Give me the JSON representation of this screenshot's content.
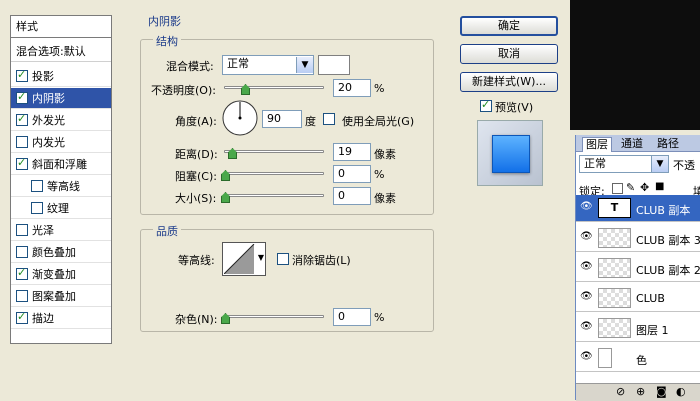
{
  "sidebar": {
    "header": "样式",
    "blend_options": "混合选项:默认",
    "items": [
      {
        "label": "投影",
        "checked": true,
        "indent": false,
        "selected": false
      },
      {
        "label": "内阴影",
        "checked": true,
        "indent": false,
        "selected": true
      },
      {
        "label": "外发光",
        "checked": true,
        "indent": false,
        "selected": false
      },
      {
        "label": "内发光",
        "checked": false,
        "indent": false,
        "selected": false
      },
      {
        "label": "斜面和浮雕",
        "checked": true,
        "indent": false,
        "selected": false
      },
      {
        "label": "等高线",
        "checked": false,
        "indent": true,
        "selected": false
      },
      {
        "label": "纹理",
        "checked": false,
        "indent": true,
        "selected": false
      },
      {
        "label": "光泽",
        "checked": false,
        "indent": false,
        "selected": false
      },
      {
        "label": "颜色叠加",
        "checked": false,
        "indent": false,
        "selected": false
      },
      {
        "label": "渐变叠加",
        "checked": true,
        "indent": false,
        "selected": false
      },
      {
        "label": "图案叠加",
        "checked": false,
        "indent": false,
        "selected": false
      },
      {
        "label": "描边",
        "checked": true,
        "indent": false,
        "selected": false
      }
    ]
  },
  "main": {
    "section_title": "内阴影",
    "structure": {
      "title": "结构",
      "blend_mode_label": "混合模式:",
      "blend_mode_value": "正常",
      "opacity_label": "不透明度(O):",
      "opacity_value": "20",
      "opacity_unit": "%",
      "opacity_fraction": 0.2,
      "angle_label": "角度(A):",
      "angle_value": "90",
      "angle_unit": "度",
      "global_light_label": "使用全局光(G)",
      "global_light_checked": false,
      "distance_label": "距离(D):",
      "distance_value": "19",
      "distance_unit": "像素",
      "distance_fraction": 0.07,
      "choke_label": "阻塞(C):",
      "choke_value": "0",
      "choke_unit": "%",
      "size_label": "大小(S):",
      "size_value": "0",
      "size_unit": "像素"
    },
    "quality": {
      "title": "品质",
      "contour_label": "等高线:",
      "antialias_label": "消除锯齿(L)",
      "antialias_checked": false,
      "noise_label": "杂色(N):",
      "noise_value": "0",
      "noise_unit": "%"
    }
  },
  "buttons": {
    "ok": "确定",
    "cancel": "取消",
    "new_style": "新建样式(W)...",
    "preview_label": "预览(V)",
    "preview_checked": true
  },
  "layers_panel": {
    "tabs": [
      "图层",
      "通道",
      "路径"
    ],
    "blend_mode": "正常",
    "opacity_label": "不透",
    "lock_label": "锁定:",
    "fill_label": "填",
    "layers": [
      {
        "name": "CLUB 副本",
        "type": "text",
        "selected": true
      },
      {
        "name": "CLUB 副本 3",
        "type": "pixel",
        "selected": false
      },
      {
        "name": "CLUB 副本 2",
        "type": "pixel",
        "selected": false
      },
      {
        "name": "CLUB",
        "type": "pixel",
        "selected": false
      },
      {
        "name": "图层 1",
        "type": "pixel",
        "selected": false
      },
      {
        "name": "色",
        "type": "adjust",
        "selected": false
      }
    ]
  },
  "colors": {
    "selection": "#2f54a8",
    "preview_fill": "#1a7cf0"
  }
}
